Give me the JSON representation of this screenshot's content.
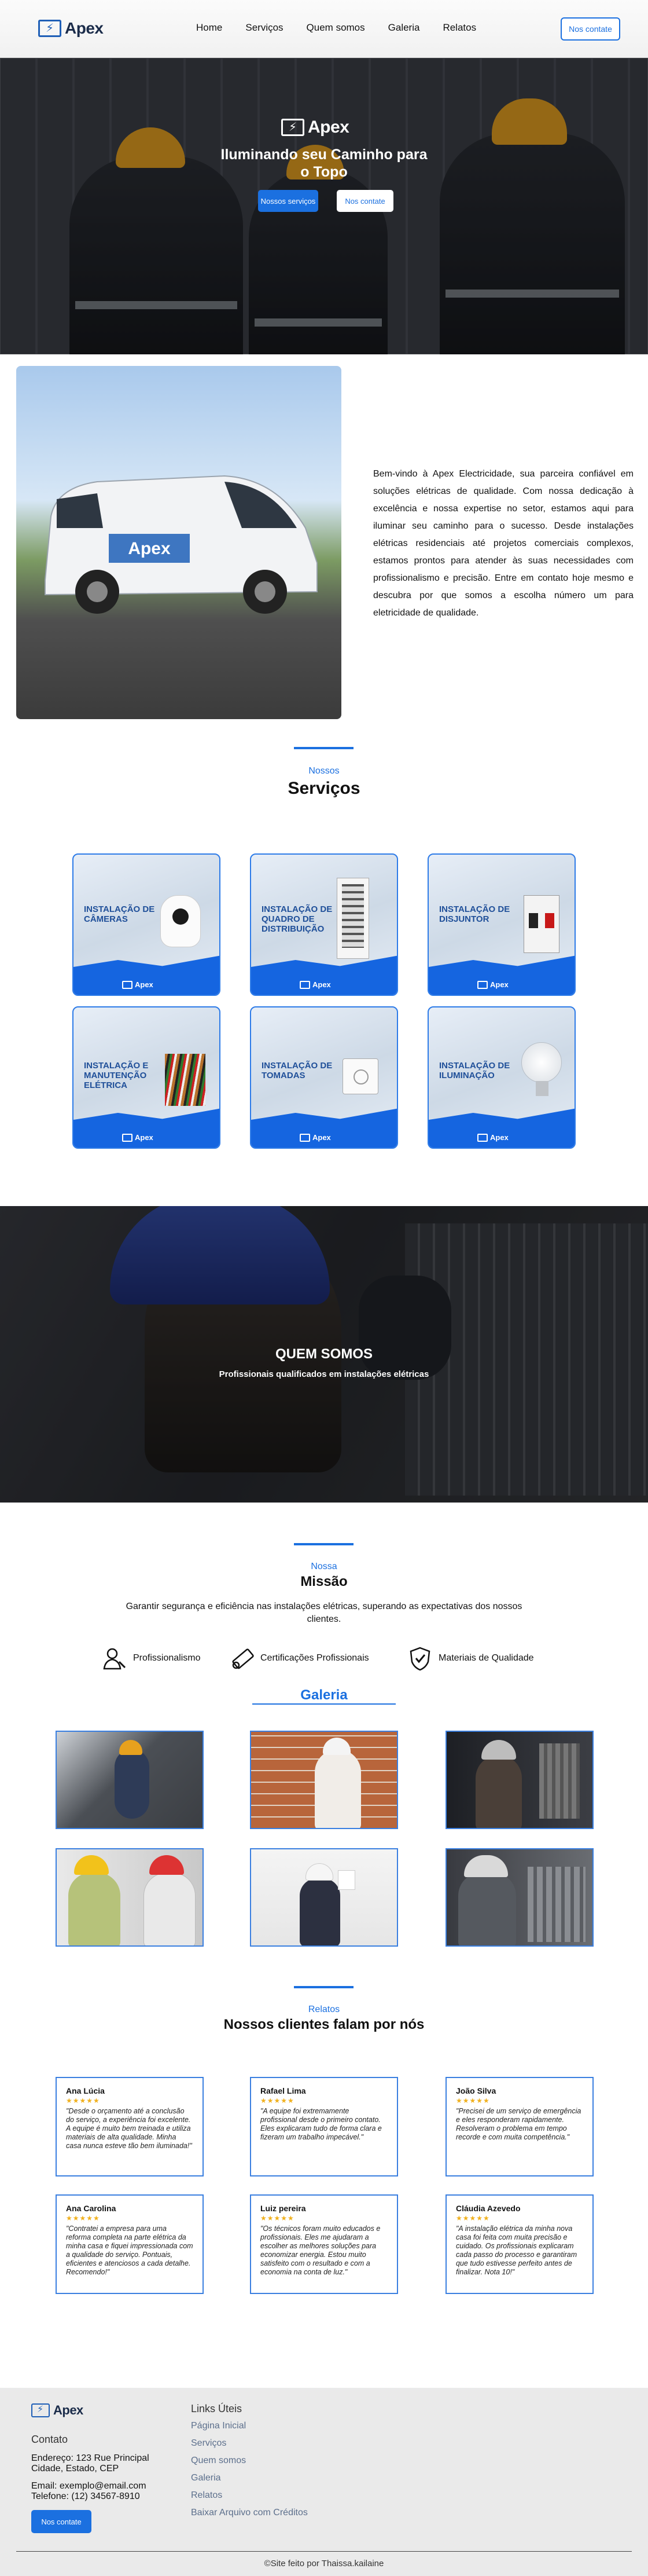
{
  "brand": {
    "name": "Apex"
  },
  "nav": {
    "items": [
      "Home",
      "Serviços",
      "Quem somos",
      "Galeria",
      "Relatos"
    ],
    "contact_button": "Nos contate"
  },
  "hero": {
    "title": "Iluminando seu Caminho para o Topo",
    "button_services": "Nossos serviços",
    "button_contact": "Nos contate"
  },
  "about": {
    "text": "Bem-vindo à Apex Electricidade, sua parceira confiável em soluções elétricas de qualidade. Com nossa dedicação à excelência e nossa expertise no setor, estamos aqui para iluminar seu caminho para o sucesso. Desde instalações elétricas residenciais até projetos comerciais complexos, estamos prontos para atender às suas necessidades com profissionalismo e precisão. Entre em contato hoje mesmo e descubra por que somos a escolha número um para eletricidade de qualidade."
  },
  "services": {
    "small": "Nossos",
    "title": "Serviços",
    "items": [
      {
        "label": "INSTALAÇÃO DE CÂMERAS",
        "icon": "camera-icon"
      },
      {
        "label": "INSTALAÇÃO DE QUADRO DE DISTRIBUIÇÃO",
        "icon": "distribution-board-icon"
      },
      {
        "label": "INSTALAÇÃO DE DISJUNTOR",
        "icon": "breaker-icon"
      },
      {
        "label": "INSTALAÇÃO E MANUTENÇÃO ELÉTRICA",
        "icon": "cables-icon"
      },
      {
        "label": "INSTALAÇÃO DE TOMADAS",
        "icon": "outlet-icon"
      },
      {
        "label": "INSTALAÇÃO DE ILUMINAÇÃO",
        "icon": "lightbulb-icon"
      }
    ]
  },
  "about_us": {
    "title": "QUEM SOMOS",
    "subtitle": "Profissionais qualificados em instalações elétricas"
  },
  "mission": {
    "small": "Nossa",
    "title": "Missão",
    "text": "Garantir segurança e eficiência nas instalações elétricas, superando as expectativas dos nossos clientes.",
    "values": [
      {
        "label": "Profissionalismo",
        "icon": "professional-icon"
      },
      {
        "label": "Certificações Profissionais",
        "icon": "certificate-icon"
      },
      {
        "label": "Materiais de Qualidade",
        "icon": "quality-shield-icon"
      }
    ]
  },
  "gallery": {
    "title": "Galeria"
  },
  "testimonials": {
    "small": "Relatos",
    "title": "Nossos clientes falam por nós",
    "items": [
      {
        "name": "Ana Lúcia",
        "stars": "★★★★★",
        "text": "\"Desde o orçamento até a conclusão do serviço, a experiência foi excelente. A equipe é muito bem treinada e utiliza materiais de alta qualidade. Minha casa nunca esteve tão bem iluminada!\""
      },
      {
        "name": "Rafael Lima",
        "stars": "★★★★★",
        "text": "\"A equipe foi extremamente profissional desde o primeiro contato. Eles explicaram tudo de forma clara e fizeram um trabalho impecável.\""
      },
      {
        "name": "João Silva",
        "stars": "★★★★★",
        "text": "\"Precisei de um serviço de emergência e eles responderam rapidamente. Resolveram o problema em tempo recorde e com muita competência.\""
      },
      {
        "name": "Ana Carolina",
        "stars": "★★★★★",
        "text": "\"Contratei a empresa para uma reforma completa na parte elétrica da minha casa e fiquei impressionada com a qualidade do serviço. Pontuais, eficientes e atenciosos a cada detalhe. Recomendo!\""
      },
      {
        "name": "Luiz pereira",
        "stars": "★★★★★",
        "text": "\"Os técnicos foram muito educados e profissionais. Eles me ajudaram a escolher as melhores soluções para economizar energia. Estou muito satisfeito com o resultado e com a economia na conta de luz.\""
      },
      {
        "name": "Cláudia Azevedo",
        "stars": "★★★★★",
        "text": "\"A instalação elétrica da minha nova casa foi feita com muita precisão e cuidado. Os profissionais explicaram cada passo do processo e garantiram que tudo estivesse perfeito antes de finalizar. Nota 10!\""
      }
    ]
  },
  "footer": {
    "contact_title": "Contato",
    "address": "Endereço: 123 Rue Principal Cidade, Estado, CEP",
    "email": "Email: exemplo@email.com",
    "phone": "Telefone: (12) 34567-8910",
    "button": "Nos contate",
    "links_title": "Links Úteis",
    "links": [
      "Página Inicial",
      "Serviços",
      "Quem somos",
      "Galeria",
      "Relatos",
      "Baixar Arquivo com Créditos"
    ],
    "copyright": "©Site feito por Thaissa.kailaine"
  },
  "colors": {
    "accent": "#1b70e0",
    "navy": "#1b2c4a",
    "footer_bg": "#eaeaea"
  }
}
